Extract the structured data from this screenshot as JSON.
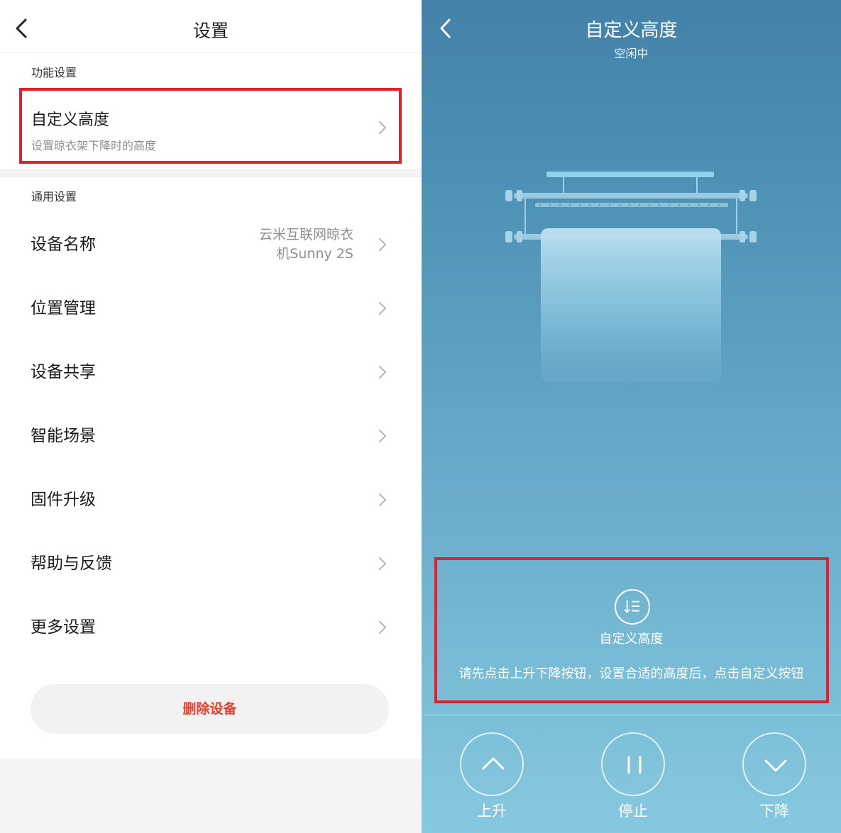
{
  "settings": {
    "title": "设置",
    "function_section": "功能设置",
    "custom_height": {
      "label": "自定义高度",
      "subtitle": "设置晾衣架下降时的高度"
    },
    "general_section": "通用设置",
    "items": [
      {
        "label": "设备名称",
        "value": "云米互联网晾衣机Sunny 2S"
      },
      {
        "label": "位置管理"
      },
      {
        "label": "设备共享"
      },
      {
        "label": "智能场景"
      },
      {
        "label": "固件升级"
      },
      {
        "label": "帮助与反馈"
      },
      {
        "label": "更多设置"
      }
    ],
    "delete_button": "删除设备"
  },
  "custom_panel": {
    "title": "自定义高度",
    "status": "空闲中",
    "hint_title": "自定义高度",
    "hint_text": "请先点击上升下降按钮，设置合适的高度后，点击自定义按钮",
    "controls": {
      "up": "上升",
      "stop": "停止",
      "down": "下降"
    }
  },
  "colors": {
    "highlight": "#e3212b",
    "danger_text": "#e8402f",
    "panel_top": "#4382a8",
    "panel_bottom": "#86c8df"
  },
  "icons": [
    "back-arrow-icon",
    "chevron-right-icon",
    "custom-height-icon",
    "arrow-up-icon",
    "pause-icon",
    "arrow-down-icon"
  ]
}
